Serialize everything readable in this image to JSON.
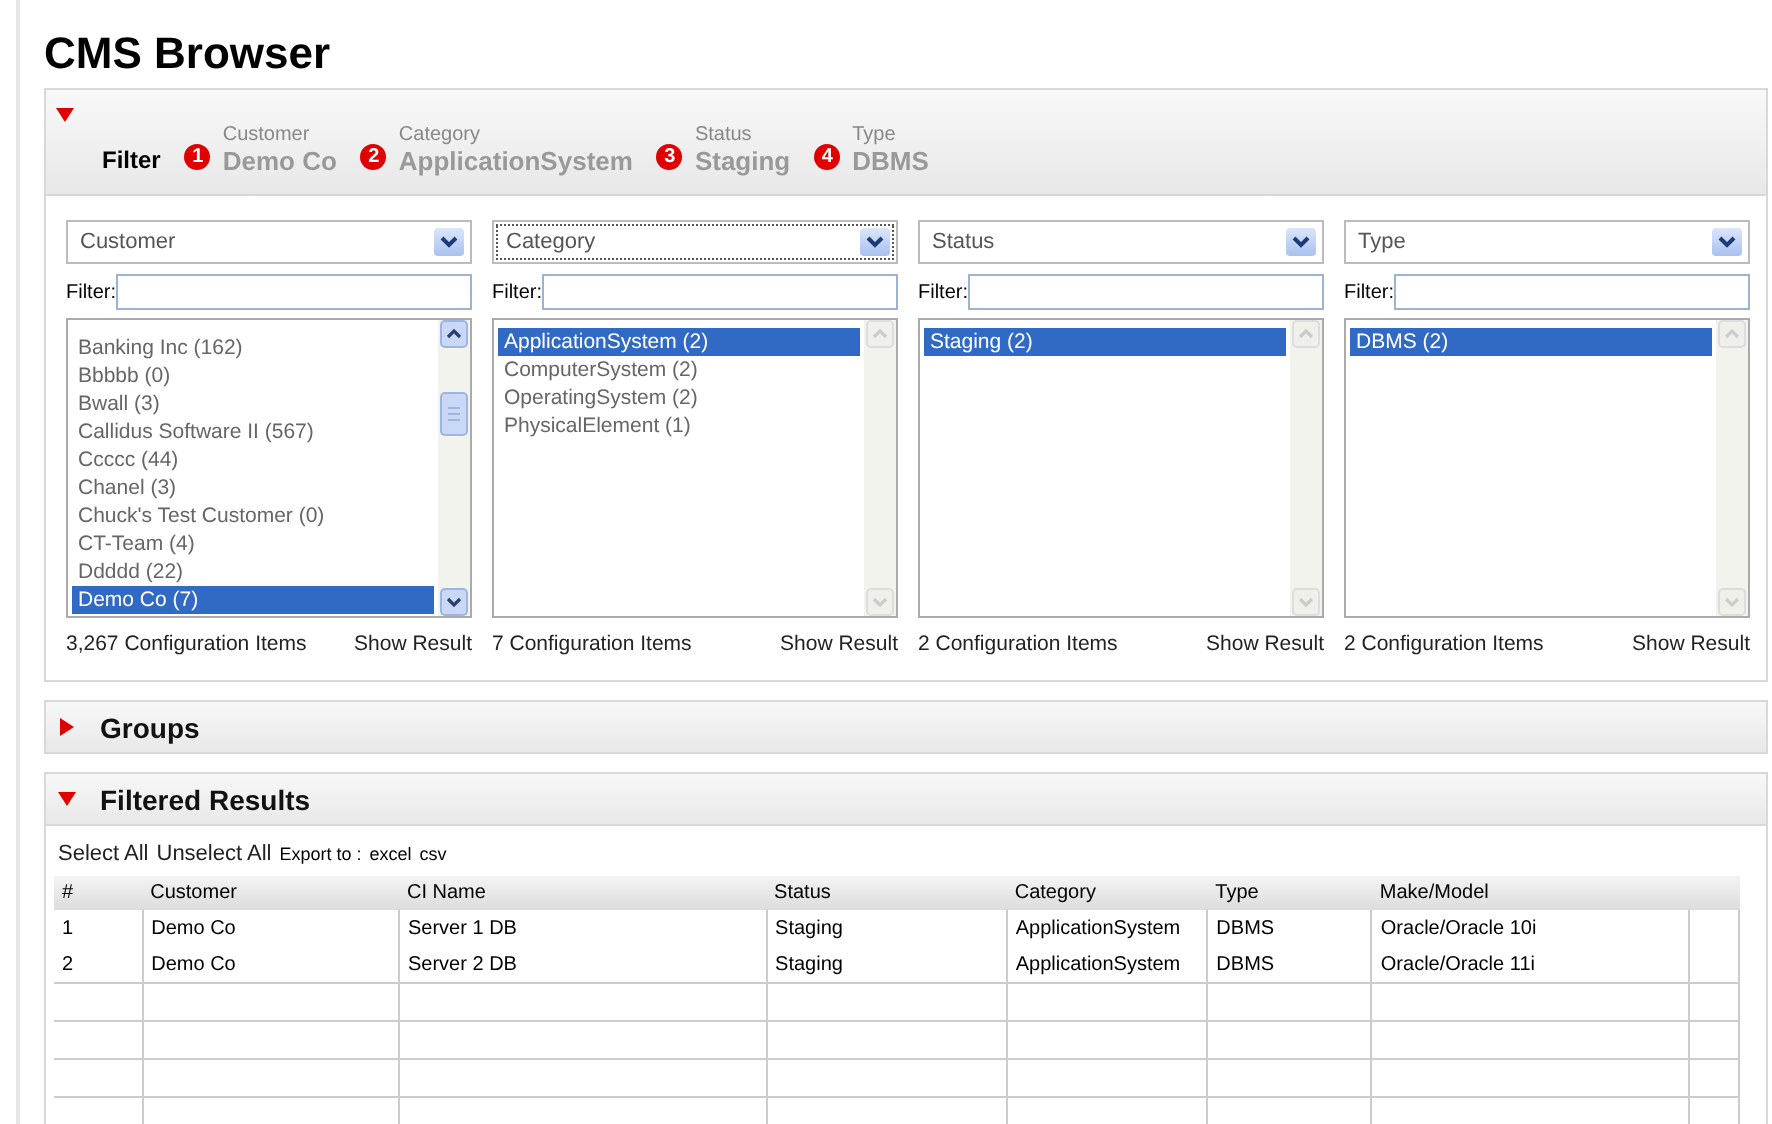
{
  "title": "CMS Browser",
  "filter_panel": {
    "expanded": true,
    "label": "Filter",
    "steps": [
      {
        "number": "1",
        "label": "Customer",
        "value": "Demo Co"
      },
      {
        "number": "2",
        "label": "Category",
        "value": "ApplicationSystem"
      },
      {
        "number": "3",
        "label": "Status",
        "value": "Staging"
      },
      {
        "number": "4",
        "label": "Type",
        "value": "DBMS"
      }
    ],
    "columns": [
      {
        "dropdown": "Customer",
        "focused": false,
        "filter_label": "Filter:",
        "scrollable": true,
        "items": [
          {
            "label": "Banking Inc (162)",
            "selected": false
          },
          {
            "label": "Bbbbb (0)",
            "selected": false
          },
          {
            "label": "Bwall (3)",
            "selected": false
          },
          {
            "label": "Callidus Software II (567)",
            "selected": false
          },
          {
            "label": "Ccccc (44)",
            "selected": false
          },
          {
            "label": "Chanel (3)",
            "selected": false
          },
          {
            "label": "Chuck's Test Customer (0)",
            "selected": false
          },
          {
            "label": "CT-Team (4)",
            "selected": false
          },
          {
            "label": "Ddddd (22)",
            "selected": false
          },
          {
            "label": "Demo Co (7)",
            "selected": true
          }
        ],
        "count": "3,267 Configuration Items",
        "action": "Show Result"
      },
      {
        "dropdown": "Category",
        "focused": true,
        "filter_label": "Filter:",
        "scrollable": false,
        "items": [
          {
            "label": "ApplicationSystem (2)",
            "selected": true
          },
          {
            "label": "ComputerSystem (2)",
            "selected": false
          },
          {
            "label": "OperatingSystem (2)",
            "selected": false
          },
          {
            "label": "PhysicalElement (1)",
            "selected": false
          }
        ],
        "count": "7 Configuration Items",
        "action": "Show Result"
      },
      {
        "dropdown": "Status",
        "focused": false,
        "filter_label": "Filter:",
        "scrollable": false,
        "items": [
          {
            "label": "Staging (2)",
            "selected": true
          }
        ],
        "count": "2 Configuration Items",
        "action": "Show Result"
      },
      {
        "dropdown": "Type",
        "focused": false,
        "filter_label": "Filter:",
        "scrollable": false,
        "items": [
          {
            "label": "DBMS (2)",
            "selected": true
          }
        ],
        "count": "2 Configuration Items",
        "action": "Show Result"
      }
    ]
  },
  "groups": {
    "title": "Groups",
    "expanded": false
  },
  "results": {
    "title": "Filtered Results",
    "expanded": true,
    "actions": [
      "Select All",
      "Unselect All"
    ],
    "export_label": "Export to :",
    "export_links": [
      "excel",
      "csv"
    ],
    "table": {
      "columns": [
        "#",
        "Customer",
        "CI Name",
        "Status",
        "Category",
        "Type",
        "Make/Model"
      ],
      "rows": [
        [
          "1",
          "Demo Co",
          "Server 1 DB",
          "Staging",
          "ApplicationSystem",
          "DBMS",
          "Oracle/Oracle 10i"
        ],
        [
          "2",
          "Demo Co",
          "Server 2 DB",
          "Staging",
          "ApplicationSystem",
          "DBMS",
          "Oracle/Oracle 11i"
        ]
      ]
    }
  }
}
